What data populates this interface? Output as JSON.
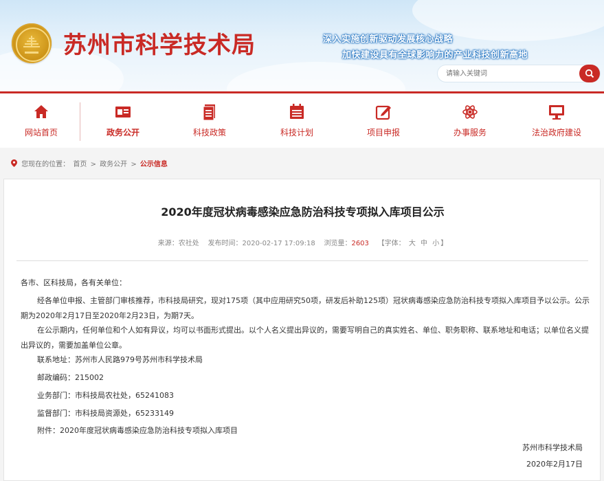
{
  "header": {
    "site_title": "苏州市科学技术局",
    "slogan_1": "深入实施创新驱动发展核心战略",
    "slogan_2": "加快建设具有全球影响力的产业科技创新高地",
    "search_placeholder": "请输入关键词"
  },
  "nav": {
    "items": [
      {
        "label": "网站首页",
        "icon": "home-icon"
      },
      {
        "label": "政务公开",
        "icon": "id-card-icon"
      },
      {
        "label": "科技政策",
        "icon": "document-icon"
      },
      {
        "label": "科技计划",
        "icon": "calendar-icon"
      },
      {
        "label": "项目申报",
        "icon": "edit-icon"
      },
      {
        "label": "办事服务",
        "icon": "atom-icon"
      },
      {
        "label": "法治政府建设",
        "icon": "monitor-icon"
      }
    ],
    "active_index": 1
  },
  "breadcrumb": {
    "prefix": "您现在的位置：",
    "sep": ">",
    "items": [
      "首页",
      "政务公开",
      "公示信息"
    ]
  },
  "article": {
    "title": "2020年度冠状病毒感染应急防治科技专项拟入库项目公示",
    "meta": {
      "source": "来源：农社处",
      "date": "发布时间：2020-02-17 17:09:18",
      "views_label": "浏览量：",
      "views": "2603",
      "font_label": "【字体：",
      "font_large": "大",
      "font_medium": "中",
      "font_small": "小",
      "font_close": "】"
    },
    "greeting": "各市、区科技局，各有关单位：",
    "para1": "经各单位申报、主管部门审核推荐，市科技局研究，现对175项（其中应用研究50项，研发后补助125项）冠状病毒感染应急防治科技专项拟入库项目予以公示。公示期为2020年2月17日至2020年2月23日，为期7天。",
    "para2": "在公示期内，任何单位和个人如有异议，均可以书面形式提出。以个人名义提出异议的，需要写明自己的真实姓名、单位、职务职称、联系地址和电话；以单位名义提出异议的，需要加盖单位公章。",
    "address": "联系地址：苏州市人民路979号苏州市科学技术局",
    "postcode": "邮政编码：215002",
    "business_dept": "业务部门：市科技局农社处，65241083",
    "supervise_dept": "监督部门：市科技局资源处，65233149",
    "attachment": "附件：2020年度冠状病毒感染应急防治科技专项拟入库项目",
    "signature": "苏州市科学技术局",
    "sign_date": "2020年2月17日"
  },
  "colors": {
    "accent": "#c92a25",
    "header_bg": "#d7ebf9"
  }
}
